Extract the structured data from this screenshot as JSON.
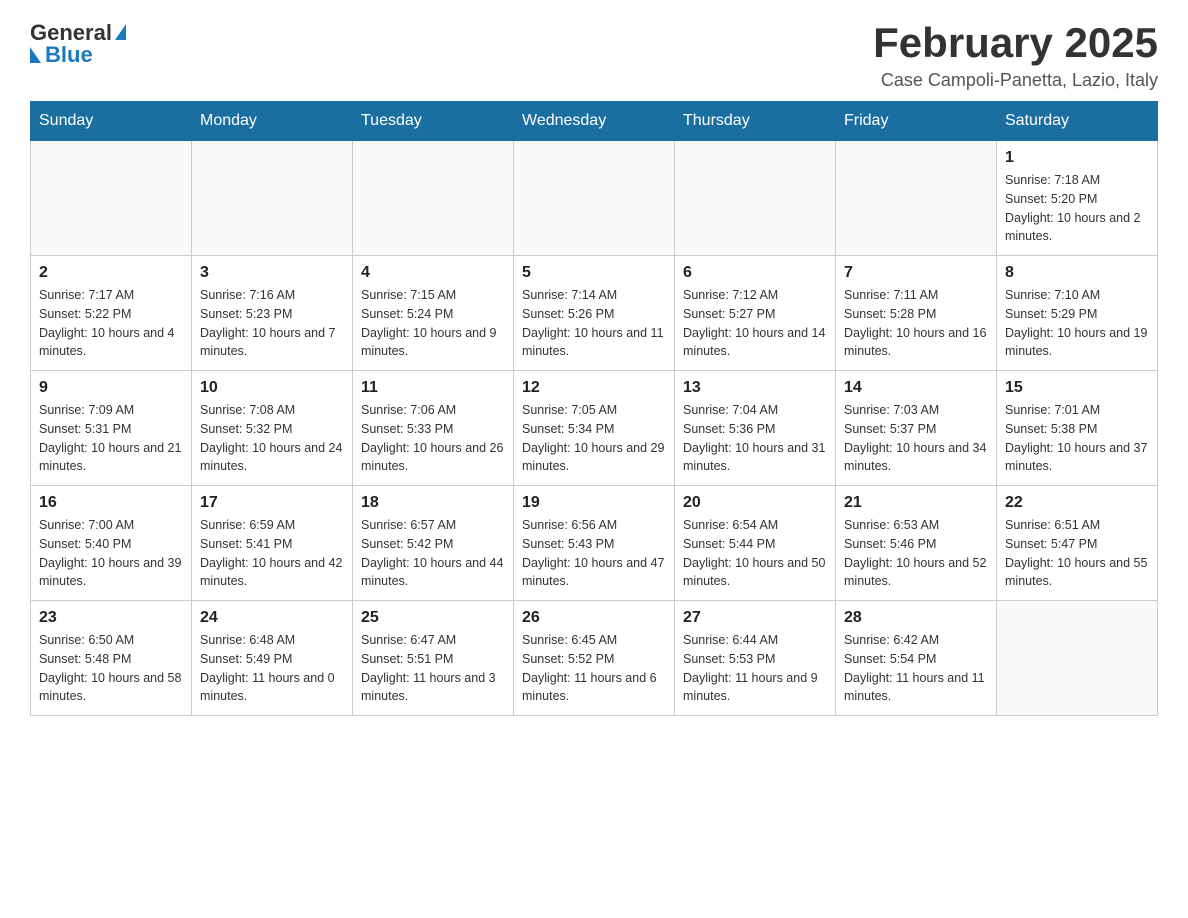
{
  "header": {
    "logo": {
      "general": "General",
      "blue": "Blue"
    },
    "title": "February 2025",
    "subtitle": "Case Campoli-Panetta, Lazio, Italy"
  },
  "weekdays": [
    "Sunday",
    "Monday",
    "Tuesday",
    "Wednesday",
    "Thursday",
    "Friday",
    "Saturday"
  ],
  "weeks": [
    [
      {
        "day": "",
        "info": ""
      },
      {
        "day": "",
        "info": ""
      },
      {
        "day": "",
        "info": ""
      },
      {
        "day": "",
        "info": ""
      },
      {
        "day": "",
        "info": ""
      },
      {
        "day": "",
        "info": ""
      },
      {
        "day": "1",
        "info": "Sunrise: 7:18 AM\nSunset: 5:20 PM\nDaylight: 10 hours and 2 minutes."
      }
    ],
    [
      {
        "day": "2",
        "info": "Sunrise: 7:17 AM\nSunset: 5:22 PM\nDaylight: 10 hours and 4 minutes."
      },
      {
        "day": "3",
        "info": "Sunrise: 7:16 AM\nSunset: 5:23 PM\nDaylight: 10 hours and 7 minutes."
      },
      {
        "day": "4",
        "info": "Sunrise: 7:15 AM\nSunset: 5:24 PM\nDaylight: 10 hours and 9 minutes."
      },
      {
        "day": "5",
        "info": "Sunrise: 7:14 AM\nSunset: 5:26 PM\nDaylight: 10 hours and 11 minutes."
      },
      {
        "day": "6",
        "info": "Sunrise: 7:12 AM\nSunset: 5:27 PM\nDaylight: 10 hours and 14 minutes."
      },
      {
        "day": "7",
        "info": "Sunrise: 7:11 AM\nSunset: 5:28 PM\nDaylight: 10 hours and 16 minutes."
      },
      {
        "day": "8",
        "info": "Sunrise: 7:10 AM\nSunset: 5:29 PM\nDaylight: 10 hours and 19 minutes."
      }
    ],
    [
      {
        "day": "9",
        "info": "Sunrise: 7:09 AM\nSunset: 5:31 PM\nDaylight: 10 hours and 21 minutes."
      },
      {
        "day": "10",
        "info": "Sunrise: 7:08 AM\nSunset: 5:32 PM\nDaylight: 10 hours and 24 minutes."
      },
      {
        "day": "11",
        "info": "Sunrise: 7:06 AM\nSunset: 5:33 PM\nDaylight: 10 hours and 26 minutes."
      },
      {
        "day": "12",
        "info": "Sunrise: 7:05 AM\nSunset: 5:34 PM\nDaylight: 10 hours and 29 minutes."
      },
      {
        "day": "13",
        "info": "Sunrise: 7:04 AM\nSunset: 5:36 PM\nDaylight: 10 hours and 31 minutes."
      },
      {
        "day": "14",
        "info": "Sunrise: 7:03 AM\nSunset: 5:37 PM\nDaylight: 10 hours and 34 minutes."
      },
      {
        "day": "15",
        "info": "Sunrise: 7:01 AM\nSunset: 5:38 PM\nDaylight: 10 hours and 37 minutes."
      }
    ],
    [
      {
        "day": "16",
        "info": "Sunrise: 7:00 AM\nSunset: 5:40 PM\nDaylight: 10 hours and 39 minutes."
      },
      {
        "day": "17",
        "info": "Sunrise: 6:59 AM\nSunset: 5:41 PM\nDaylight: 10 hours and 42 minutes."
      },
      {
        "day": "18",
        "info": "Sunrise: 6:57 AM\nSunset: 5:42 PM\nDaylight: 10 hours and 44 minutes."
      },
      {
        "day": "19",
        "info": "Sunrise: 6:56 AM\nSunset: 5:43 PM\nDaylight: 10 hours and 47 minutes."
      },
      {
        "day": "20",
        "info": "Sunrise: 6:54 AM\nSunset: 5:44 PM\nDaylight: 10 hours and 50 minutes."
      },
      {
        "day": "21",
        "info": "Sunrise: 6:53 AM\nSunset: 5:46 PM\nDaylight: 10 hours and 52 minutes."
      },
      {
        "day": "22",
        "info": "Sunrise: 6:51 AM\nSunset: 5:47 PM\nDaylight: 10 hours and 55 minutes."
      }
    ],
    [
      {
        "day": "23",
        "info": "Sunrise: 6:50 AM\nSunset: 5:48 PM\nDaylight: 10 hours and 58 minutes."
      },
      {
        "day": "24",
        "info": "Sunrise: 6:48 AM\nSunset: 5:49 PM\nDaylight: 11 hours and 0 minutes."
      },
      {
        "day": "25",
        "info": "Sunrise: 6:47 AM\nSunset: 5:51 PM\nDaylight: 11 hours and 3 minutes."
      },
      {
        "day": "26",
        "info": "Sunrise: 6:45 AM\nSunset: 5:52 PM\nDaylight: 11 hours and 6 minutes."
      },
      {
        "day": "27",
        "info": "Sunrise: 6:44 AM\nSunset: 5:53 PM\nDaylight: 11 hours and 9 minutes."
      },
      {
        "day": "28",
        "info": "Sunrise: 6:42 AM\nSunset: 5:54 PM\nDaylight: 11 hours and 11 minutes."
      },
      {
        "day": "",
        "info": ""
      }
    ]
  ]
}
